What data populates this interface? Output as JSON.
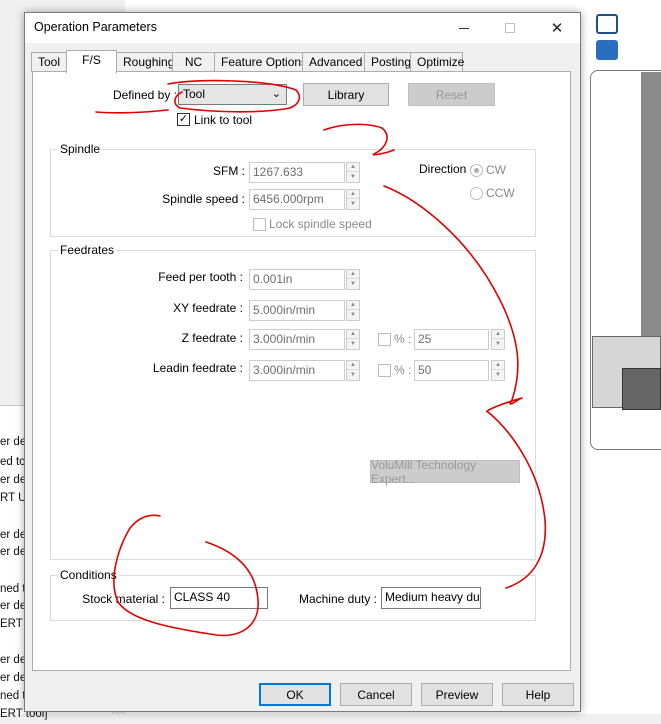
{
  "dialog": {
    "title": "Operation Parameters",
    "close_glyph": "✕",
    "tabs": [
      {
        "label": "Tool"
      },
      {
        "label": "F/S"
      },
      {
        "label": "Roughing"
      },
      {
        "label": "NC"
      },
      {
        "label": "Feature Options"
      },
      {
        "label": "Advanced"
      },
      {
        "label": "Posting"
      },
      {
        "label": "Optimize"
      }
    ],
    "active_tab": "F/S"
  },
  "defined_by": {
    "label": "Defined by :",
    "value": "Tool",
    "arrow_glyph": "⌄",
    "library_button": "Library",
    "reset_button": "Reset",
    "link_to_tool_label": "Link to tool",
    "link_to_tool_checked": true,
    "check_glyph": "✓"
  },
  "spindle": {
    "title": "Spindle",
    "sfm_label": "SFM :",
    "sfm_value": "1267.633",
    "speed_label": "Spindle speed :",
    "speed_value": "6456.000rpm",
    "lock_label": "Lock spindle speed",
    "direction_label": "Direction :",
    "cw_label": "CW",
    "ccw_label": "CCW",
    "direction_selected": "CW"
  },
  "feedrates": {
    "title": "Feedrates",
    "feed_per_tooth_label": "Feed per tooth :",
    "feed_per_tooth_value": "0.001in",
    "xy_label": "XY feedrate :",
    "xy_value": "5.000in/min",
    "z_label": "Z feedrate :",
    "z_value": "3.000in/min",
    "z_pct_label": "% :",
    "z_pct_value": "25",
    "leadin_label": "Leadin feedrate :",
    "leadin_value": "3.000in/min",
    "leadin_pct_label": "% :",
    "leadin_pct_value": "50",
    "expert_button": "VoluMill Technology Expert..."
  },
  "conditions": {
    "title": "Conditions",
    "stock_label": "Stock material :",
    "stock_value": "CLASS 40",
    "duty_label": "Machine duty :",
    "duty_value": "Medium heavy duty"
  },
  "buttons": {
    "ok": "OK",
    "cancel": "Cancel",
    "preview": "Preview",
    "help": "Help"
  },
  "background_list": [
    "er defi",
    "ed to",
    "er defi",
    "RT U",
    "er def",
    "er defi",
    "ned t",
    "er defi",
    "ERT",
    "er defi",
    "er defi",
    "ned to"
  ],
  "background_bottom_text": "ERT tool]",
  "colors": {
    "annotation_red": "#e00000",
    "focus_blue": "#0078d7"
  }
}
